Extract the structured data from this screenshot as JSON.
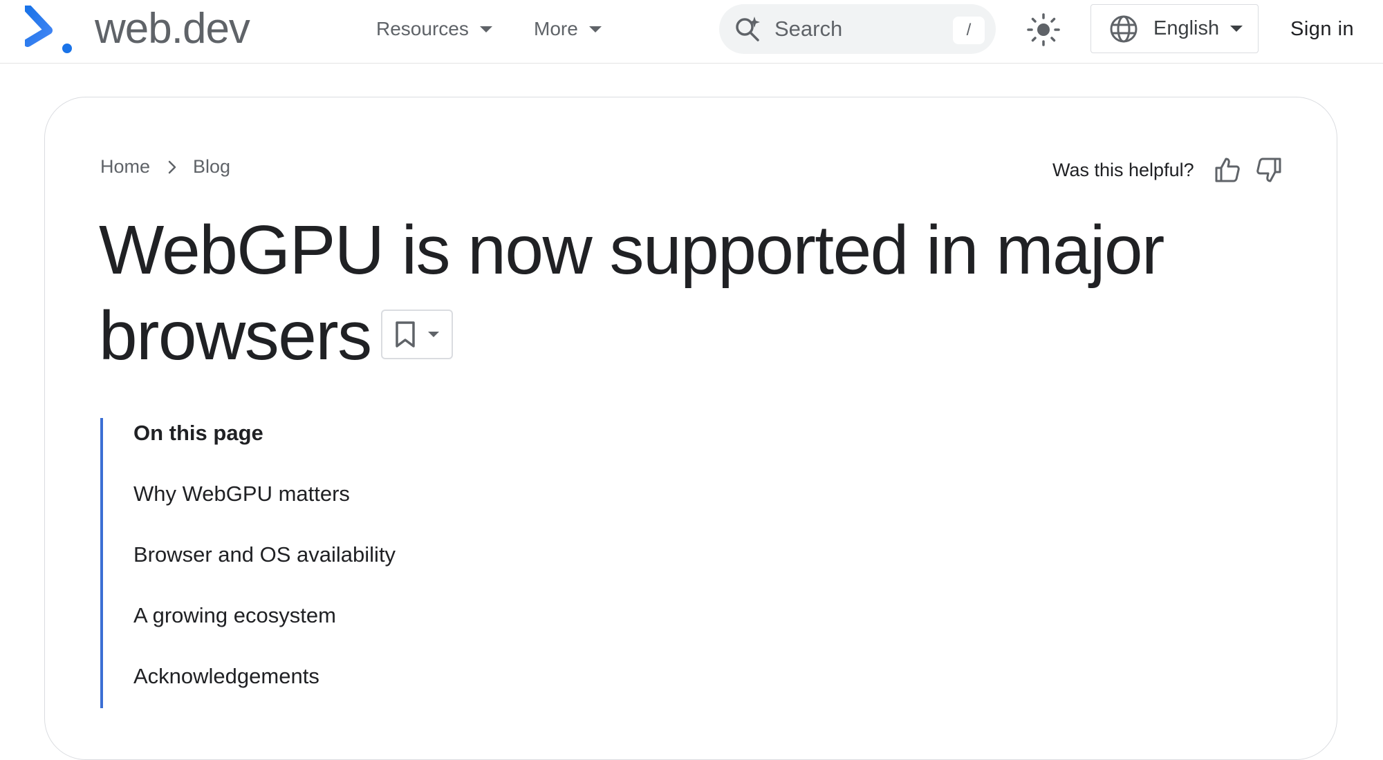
{
  "header": {
    "logo_text": "web.dev",
    "nav": [
      {
        "label": "Resources"
      },
      {
        "label": "More"
      }
    ],
    "search": {
      "placeholder": "Search",
      "shortcut": "/"
    },
    "language": {
      "selected": "English"
    },
    "sign_in_label": "Sign in"
  },
  "colors": {
    "accent_blue": "#3b6fd4",
    "text_primary": "#202124",
    "text_secondary": "#5f6368"
  },
  "breadcrumb": [
    {
      "label": "Home"
    },
    {
      "label": "Blog"
    }
  ],
  "feedback": {
    "prompt": "Was this helpful?"
  },
  "article": {
    "title": "WebGPU is now supported in major browsers"
  },
  "toc": {
    "heading": "On this page",
    "items": [
      {
        "label": "Why WebGPU matters"
      },
      {
        "label": "Browser and OS availability"
      },
      {
        "label": "A growing ecosystem"
      },
      {
        "label": "Acknowledgements"
      }
    ]
  },
  "icons": {
    "logo": "web-dev-logo-icon",
    "search": "sparkle-search-icon",
    "theme": "sun-icon",
    "language": "globe-icon",
    "breadcrumb_separator": "chevron-right-icon",
    "feedback_positive": "thumb-up-icon",
    "feedback_negative": "thumb-down-icon",
    "bookmark": "bookmark-icon"
  }
}
